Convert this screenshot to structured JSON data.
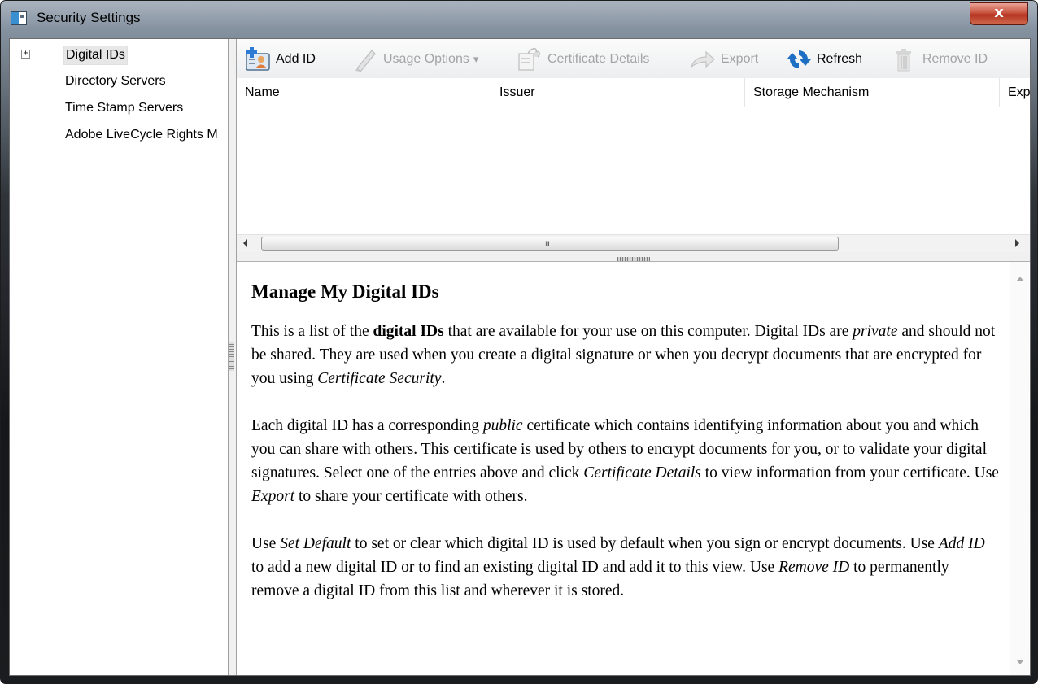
{
  "window": {
    "title": "Security Settings",
    "close_glyph": "x"
  },
  "tree": {
    "expander": "+",
    "items": [
      {
        "label": "Digital IDs",
        "selected": true
      },
      {
        "label": "Directory Servers"
      },
      {
        "label": "Time Stamp Servers"
      },
      {
        "label": "Adobe LiveCycle Rights M"
      }
    ]
  },
  "toolbar": {
    "add_id": "Add ID",
    "usage_options": "Usage Options",
    "usage_options_caret": "▾",
    "certificate_details": "Certificate Details",
    "export": "Export",
    "refresh": "Refresh",
    "remove_id": "Remove ID",
    "icons": {
      "add_id": "add-id-icon",
      "usage_options": "pen-icon",
      "certificate_details": "certificate-icon",
      "export": "export-arrow-icon",
      "refresh": "refresh-icon",
      "remove_id": "trash-icon"
    }
  },
  "list": {
    "columns": [
      "Name",
      "Issuer",
      "Storage Mechanism",
      "Exp"
    ],
    "rows": []
  },
  "hscroll": {
    "grip": "III"
  },
  "help": {
    "title": "Manage My Digital IDs",
    "p1": {
      "a": "This is a list of the ",
      "b": "digital IDs",
      "c": " that are available for your use on this computer. Digital IDs are ",
      "d": "private",
      "e": " and should not be shared. They are used when you create a digital signature or when you decrypt documents that are encrypted for you using ",
      "f": "Certificate Security",
      "g": "."
    },
    "p2": {
      "a": "Each digital ID has a corresponding ",
      "b": "public",
      "c": " certificate which contains identifying information about you and which you can share with others. This certificate is used by others to encrypt documents for you, or to validate your digital signatures. Select one of the entries above and click ",
      "d": "Certificate Details",
      "e": " to view information from your certificate. Use ",
      "f": "Export",
      "g": " to share your certificate with others."
    },
    "p3": {
      "a": "Use ",
      "b": "Set Default",
      "c": " to set or clear which digital ID is used by default when you sign or encrypt documents. Use ",
      "d": "Add ID",
      "e": " to add a new digital ID or to find an existing digital ID and add it to this view. Use ",
      "f": "Remove ID",
      "g": " to permanently remove a digital ID from this list and wherever it is stored."
    }
  },
  "colors": {
    "close_button": "#c8533f",
    "disabled_text": "#a4a4a4",
    "refresh_blue": "#1e6fc4"
  }
}
